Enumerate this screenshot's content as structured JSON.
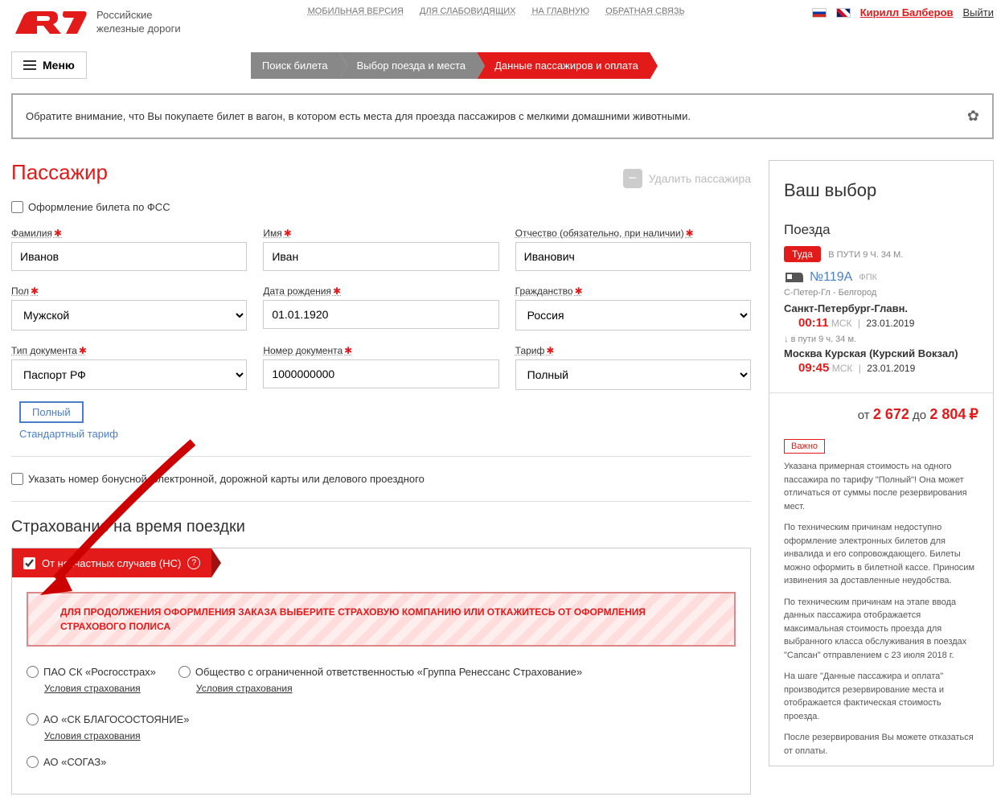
{
  "header": {
    "logo_line1": "Российские",
    "logo_line2": "железные дороги",
    "top_links": [
      "МОБИЛЬНАЯ ВЕРСИЯ",
      "ДЛЯ СЛАБОВИДЯЩИХ",
      "НА ГЛАВНУЮ",
      "ОБРАТНАЯ СВЯЗЬ"
    ],
    "username": "Кирилл Балберов",
    "logout": "Выйти",
    "menu_label": "Меню"
  },
  "breadcrumb": {
    "step1": "Поиск билета",
    "step2": "Выбор поезда и места",
    "step3": "Данные пассажиров и оплата"
  },
  "notice": "Обратите внимание, что Вы покупаете билет в вагон, в котором есть места для проезда пассажиров с мелкими домашними животными.",
  "passenger": {
    "title": "Пассажир",
    "delete_label": "Удалить пассажира",
    "fss_label": "Оформление билета по ФСС",
    "fields": {
      "surname_label": "Фамилия",
      "surname_value": "Иванов",
      "name_label": "Имя",
      "name_value": "Иван",
      "patronymic_label": "Отчество (обязательно, при наличии)",
      "patronymic_value": "Иванович",
      "gender_label": "Пол",
      "gender_value": "Мужской",
      "birthdate_label": "Дата рождения",
      "birthdate_value": "01.01.1920",
      "citizenship_label": "Гражданство",
      "citizenship_value": "Россия",
      "doctype_label": "Тип документа",
      "doctype_value": "Паспорт РФ",
      "docnum_label": "Номер документа",
      "docnum_value": "1000000000",
      "tariff_label": "Тариф",
      "tariff_value": "Полный"
    },
    "tariff_tag": "Полный",
    "tariff_link": "Стандартный тариф",
    "bonus_label": "Указать номер бонусной, электронной, дорожной карты или делового проездного"
  },
  "insurance": {
    "title": "Страхование на время поездки",
    "header_label": "От несчастных случаев (НС)",
    "warning": "ДЛЯ ПРОДОЛЖЕНИЯ ОФОРМЛЕНИЯ ЗАКАЗА ВЫБЕРИТЕ СТРАХОВУЮ КОМПАНИЮ ИЛИ ОТКАЖИТЕСЬ ОТ ОФОРМЛЕНИЯ СТРАХОВОГО ПОЛИСА",
    "opt1": "ПАО СК «Росгосстрах»",
    "opt2": "Общество с ограниченной ответственностью «Группа Ренессанс Страхование»",
    "opt3": "АО «СК БЛАГОСОСТОЯНИЕ»",
    "opt4": "АО «СОГАЗ»",
    "terms": "Условия страхования"
  },
  "sidebar": {
    "title": "Ваш выбор",
    "trains_label": "Поезда",
    "direction": "Туда",
    "travel_time": "В ПУТИ 9 Ч. 34 М.",
    "train_num": "№119А",
    "company": "ФПК",
    "route": "С-Петер-Гл - Белгород",
    "station1": "Санкт-Петербург-Главн.",
    "time1": "00:11",
    "tz": "МСК",
    "date1": "23.01.2019",
    "duration": "в пути  9 ч. 34 м.",
    "station2": "Москва Курская (Курский Вокзал)",
    "time2": "09:45",
    "date2": "23.01.2019",
    "price_from": "от",
    "price1": "2 672",
    "price_to": "до",
    "price2": "2 804",
    "currency": "₽",
    "important": "Важно",
    "info1": "Указана примерная стоимость на одного пассажира по тарифу \"Полный\"! Она может отличаться от суммы после резервирования мест.",
    "info2": "По техническим причинам недоступно оформление электронных билетов для инвалида и его сопровождающего. Билеты можно оформить в билетной кассе. Приносим извинения за доставленные неудобства.",
    "info3": "По техническим причинам на этапе ввода данных пассажира отображается максимальная стоимость проезда для выбранного класса обслуживания в поездах \"Сапсан\" отправлением с 23 июля 2018 г.",
    "info4": "На шаге \"Данные пассажира и оплата\" производится резервирование места и отображается фактическая стоимость проезда.",
    "info5": "После резервирования Вы можете отказаться от оплаты."
  }
}
